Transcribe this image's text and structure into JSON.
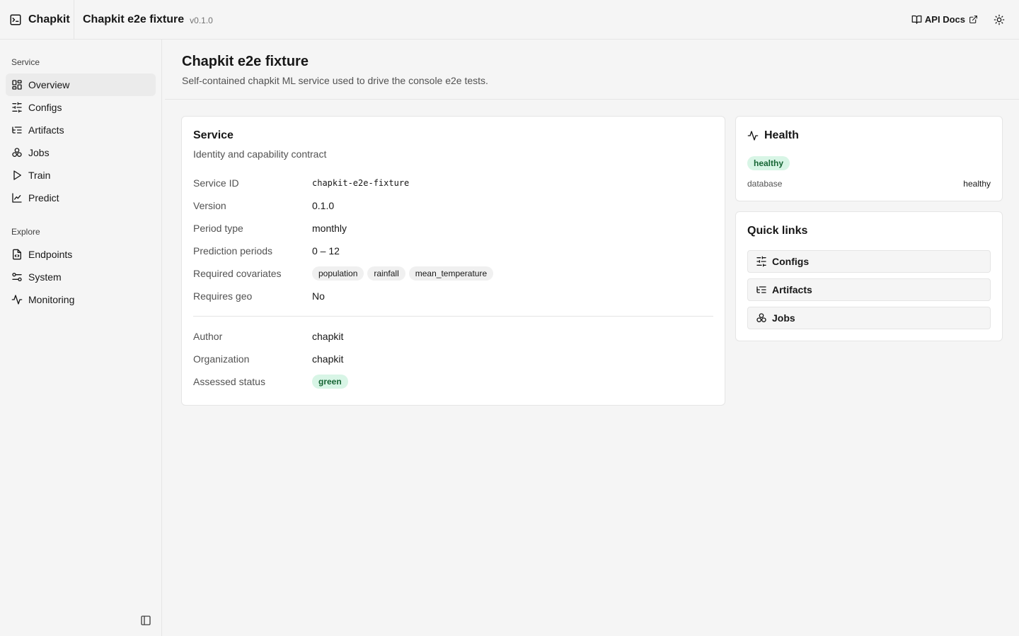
{
  "header": {
    "brand": "Chapkit",
    "service_title": "Chapkit e2e fixture",
    "version": "v0.1.0",
    "api_docs_label": "API Docs"
  },
  "sidebar": {
    "groups": [
      {
        "label": "Service",
        "items": [
          {
            "label": "Overview",
            "icon": "overview-grid-icon",
            "active": true
          },
          {
            "label": "Configs",
            "icon": "sliders-icon"
          },
          {
            "label": "Artifacts",
            "icon": "list-tree-icon"
          },
          {
            "label": "Jobs",
            "icon": "boxes-icon"
          },
          {
            "label": "Train",
            "icon": "play-icon"
          },
          {
            "label": "Predict",
            "icon": "line-chart-icon"
          }
        ]
      },
      {
        "label": "Explore",
        "items": [
          {
            "label": "Endpoints",
            "icon": "file-code-icon"
          },
          {
            "label": "System",
            "icon": "settings-toggle-icon"
          },
          {
            "label": "Monitoring",
            "icon": "activity-icon"
          }
        ]
      }
    ]
  },
  "page": {
    "title": "Chapkit e2e fixture",
    "subtitle": "Self-contained chapkit ML service used to drive the console e2e tests."
  },
  "service_card": {
    "title": "Service",
    "description": "Identity and capability contract",
    "fields": {
      "service_id": {
        "label": "Service ID",
        "value": "chapkit-e2e-fixture"
      },
      "version": {
        "label": "Version",
        "value": "0.1.0"
      },
      "period_type": {
        "label": "Period type",
        "value": "monthly"
      },
      "prediction_periods": {
        "label": "Prediction periods",
        "value": "0 – 12"
      },
      "required_covariates": {
        "label": "Required covariates",
        "values": [
          "population",
          "rainfall",
          "mean_temperature"
        ]
      },
      "requires_geo": {
        "label": "Requires geo",
        "value": "No"
      },
      "author": {
        "label": "Author",
        "value": "chapkit"
      },
      "organization": {
        "label": "Organization",
        "value": "chapkit"
      },
      "assessed_status": {
        "label": "Assessed status",
        "value": "green"
      }
    }
  },
  "health_card": {
    "title": "Health",
    "status": "healthy",
    "checks": [
      {
        "name": "database",
        "status": "healthy"
      }
    ]
  },
  "quick_links": {
    "title": "Quick links",
    "items": [
      {
        "label": "Configs",
        "icon": "sliders-icon"
      },
      {
        "label": "Artifacts",
        "icon": "list-tree-icon"
      },
      {
        "label": "Jobs",
        "icon": "boxes-icon"
      }
    ]
  },
  "colors": {
    "background": "#f5f5f5",
    "card": "#ffffff",
    "border": "#e5e5e5",
    "status_green_bg": "#d8f5e6",
    "status_green_text": "#166534"
  }
}
